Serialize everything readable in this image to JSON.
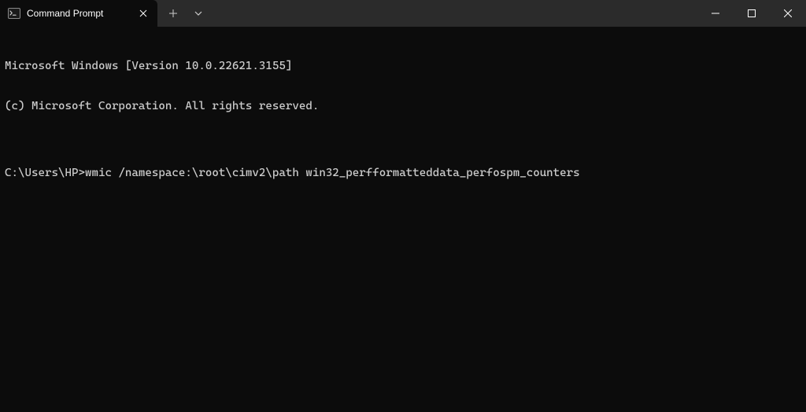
{
  "tab": {
    "title": "Command Prompt"
  },
  "terminal": {
    "line1": "Microsoft Windows [Version 10.0.22621.3155]",
    "line2": "(c) Microsoft Corporation. All rights reserved.",
    "blank": "",
    "prompt": "C:\\Users\\HP>",
    "command": "wmic /namespace:\\root\\cimv2\\path win32_perfformatteddata_perfospm_counters"
  }
}
